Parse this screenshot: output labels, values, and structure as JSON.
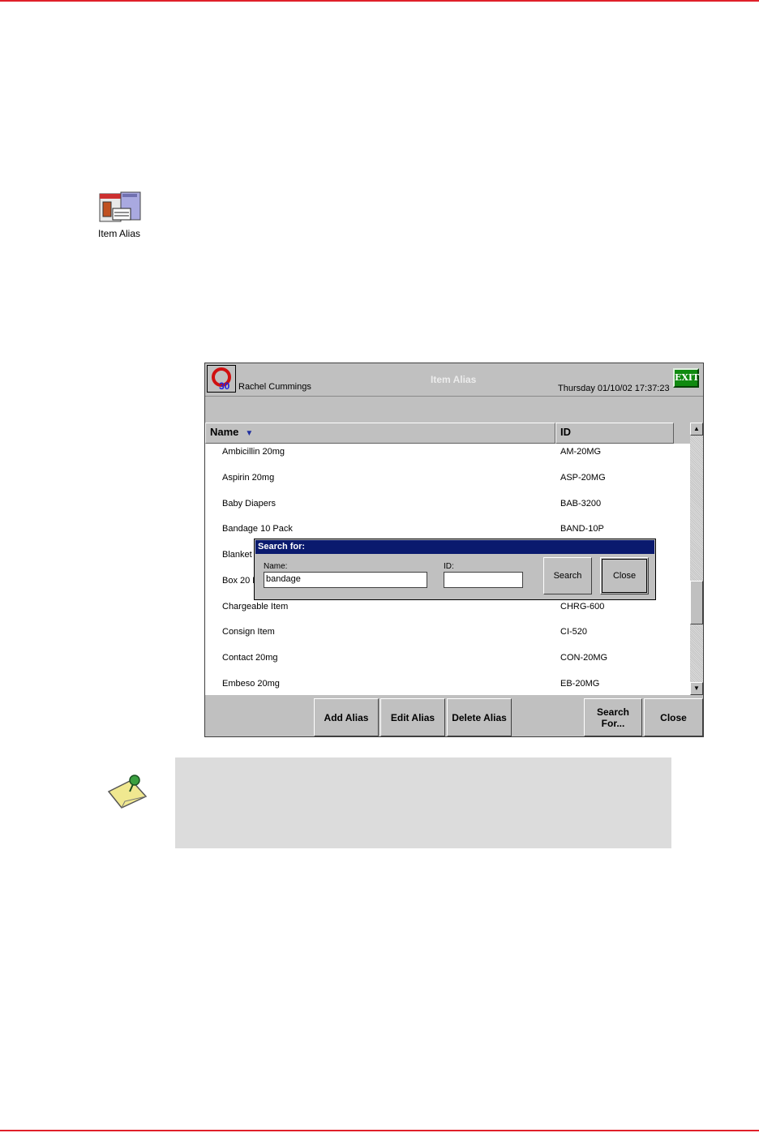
{
  "desktop_icon": {
    "label": "Item Alias",
    "icon": "item-alias-icon"
  },
  "window": {
    "user_name": "Rachel Cummings",
    "title": "Item Alias",
    "datetime": "Thursday  01/10/02 17:37:23",
    "exit_label": "EXIT",
    "logo_number": "30"
  },
  "table": {
    "columns": [
      "Name",
      "ID"
    ],
    "sort_indicator": "▼",
    "rows": [
      {
        "name": "Ambicillin 20mg",
        "id": "AM-20MG"
      },
      {
        "name": "Aspirin 20mg",
        "id": "ASP-20MG"
      },
      {
        "name": "Baby Diapers",
        "id": "BAB-3200"
      },
      {
        "name": "Bandage 10 Pack",
        "id": "BAND-10P"
      },
      {
        "name": "Blanket",
        "id": ""
      },
      {
        "name": "Box 20 F",
        "id": ""
      },
      {
        "name": "Chargeable Item",
        "id": "CHRG-600"
      },
      {
        "name": "Consign Item",
        "id": "CI-520"
      },
      {
        "name": "Contact 20mg",
        "id": "CON-20MG"
      },
      {
        "name": "Embeso 20mg",
        "id": "EB-20MG"
      }
    ]
  },
  "search_dialog": {
    "title": "Search for:",
    "name_label": "Name:",
    "name_value": "bandage",
    "id_label": "ID:",
    "id_value": "",
    "search_label": "Search",
    "close_label": "Close"
  },
  "buttons": {
    "add_alias": "Add Alias",
    "edit_alias": "Edit Alias",
    "delete_alias": "Delete Alias",
    "search_for_line1": "Search",
    "search_for_line2": "For...",
    "close": "Close"
  },
  "colors": {
    "page_rule": "#e0202a",
    "dialog_title": "#0a1a6e",
    "exit_button": "#108a10",
    "window_bg": "#c0c0c0"
  }
}
